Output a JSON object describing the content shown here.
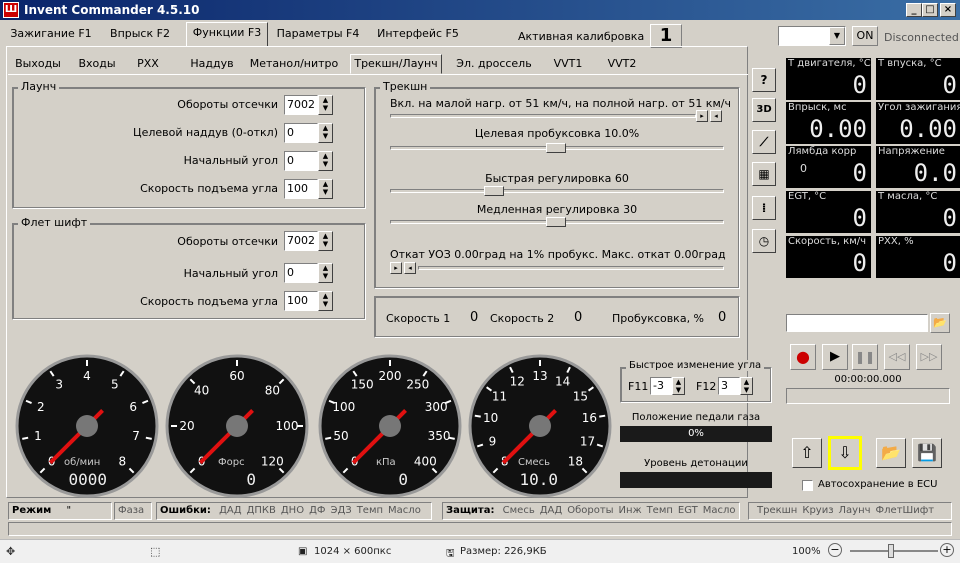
{
  "window": {
    "title": "Invent Commander 4.5.10",
    "min": "_",
    "max": "□",
    "close": "×"
  },
  "main_tabs": [
    {
      "label": "Зажигание F1"
    },
    {
      "label": "Впрыск F2"
    },
    {
      "label": "Функции F3"
    },
    {
      "label": "Параметры F4"
    },
    {
      "label": "Интерфейс F5"
    }
  ],
  "calibration": {
    "label": "Активная калибровка",
    "value": "1"
  },
  "connection": {
    "port_value": "",
    "on_label": "ON",
    "status": "Disconnected"
  },
  "sub_tabs": [
    {
      "label": "Выходы"
    },
    {
      "label": "Входы"
    },
    {
      "label": "РХХ"
    },
    {
      "label": "Наддув"
    },
    {
      "label": "Метанол/нитро"
    },
    {
      "label": "Трекшн/Лаунч"
    },
    {
      "label": "Эл. дроссель"
    },
    {
      "label": "VVT1"
    },
    {
      "label": "VVT2"
    }
  ],
  "launch": {
    "title": "Лаунч",
    "fields": [
      {
        "label": "Обороты отсечки",
        "value": "7002"
      },
      {
        "label": "Целевой наддув (0-откл)",
        "value": "0"
      },
      {
        "label": "Начальный угол",
        "value": "0"
      },
      {
        "label": "Скорость подъема угла",
        "value": "100"
      }
    ]
  },
  "flat_shift": {
    "title": "Флет шифт",
    "fields": [
      {
        "label": "Обороты отсечки",
        "value": "7002"
      },
      {
        "label": "Начальный угол",
        "value": "0"
      },
      {
        "label": "Скорость подъема угла",
        "value": "100"
      }
    ]
  },
  "traction": {
    "title": "Трекшн",
    "enable_text": "Вкл. на малой нагр. от 51 км/ч, на полной нагр. от 51 км/ч",
    "target_slip": "Целевая пробуксовка 10.0%",
    "fast_adj": "Быстрая регулировка 60",
    "slow_adj": "Медленная регулировка 30",
    "retard": "Откат УОЗ 0.00град на 1% пробукс.  Макс. откат 0.00град"
  },
  "speeds": {
    "speed1_label": "Скорость 1",
    "speed1": "0",
    "speed2_label": "Скорость 2",
    "speed2": "0",
    "slip_label": "Пробуксовка, %",
    "slip": "0"
  },
  "side_icons": [
    {
      "label": "?"
    },
    {
      "label": "3D"
    },
    {
      "label": "⟋"
    },
    {
      "label": "▦"
    },
    {
      "label": "⁞"
    },
    {
      "label": "◷"
    }
  ],
  "tiles": [
    {
      "caption": "Т двигателя, °С",
      "value": "0"
    },
    {
      "caption": "Т впуска, °С",
      "value": "0"
    },
    {
      "caption": "Впрыск, мс",
      "value": "0.00"
    },
    {
      "caption": "Угол зажигания",
      "value": "0.00"
    },
    {
      "caption": "Лямбда корр",
      "value": "0",
      "sub": "0"
    },
    {
      "caption": "Напряжение",
      "value": "0.0"
    },
    {
      "caption": "EGT, °C",
      "value": "0"
    },
    {
      "caption": "Т масла, °С",
      "value": "0"
    },
    {
      "caption": "Скорость, км/ч",
      "value": "0"
    },
    {
      "caption": "РХХ, %",
      "value": "0"
    }
  ],
  "player": {
    "time": "00:00:00.000"
  },
  "gauges": [
    {
      "unit": "об/мин",
      "digits": "0000",
      "ticks": [
        "0",
        "1",
        "2",
        "3",
        "4",
        "5",
        "6",
        "7",
        "8"
      ]
    },
    {
      "unit": "Форс",
      "digits": "0",
      "ticks": [
        "0",
        "20",
        "40",
        "60",
        "80",
        "100",
        "120"
      ]
    },
    {
      "unit": "кПа",
      "digits": "0",
      "ticks": [
        "0",
        "50",
        "100",
        "150",
        "200",
        "250",
        "300",
        "350",
        "400"
      ]
    },
    {
      "unit": "Смесь",
      "digits": "10.0",
      "ticks": [
        "8",
        "9",
        "10",
        "11",
        "12",
        "13",
        "14",
        "15",
        "16",
        "17",
        "18"
      ]
    }
  ],
  "quick_angle": {
    "title": "Быстрое изменение угла",
    "f11_label": "F11",
    "f11_value": "-3",
    "f12_label": "F12",
    "f12_value": "3"
  },
  "pedal": {
    "label": "Положение педали газа",
    "value": "0%"
  },
  "knock": {
    "label": "Уровень детонации",
    "value": ""
  },
  "autosave": {
    "label": "Автосохранение в ECU"
  },
  "status_bar": {
    "mode_label": "Режим",
    "mode_value": "\"",
    "phase": "Фаза",
    "errors_label": "Ошибки:",
    "errors": [
      "ДАД",
      "ДПКВ",
      "ДНО",
      "ДФ",
      "ЭДЗ",
      "Темп",
      "Масло"
    ],
    "protect_label": "Защита:",
    "protect": [
      "Смесь",
      "ДАД",
      "Обороты",
      "Инж",
      "Темп",
      "EGT",
      "Масло"
    ],
    "modes": [
      "Трекшн",
      "Круиз",
      "Лаунч",
      "ФлетШифт"
    ]
  },
  "viewer_bar": {
    "dims": "1024 × 600пкс",
    "size": "Размер: 226,9КБ",
    "zoom": "100%"
  }
}
